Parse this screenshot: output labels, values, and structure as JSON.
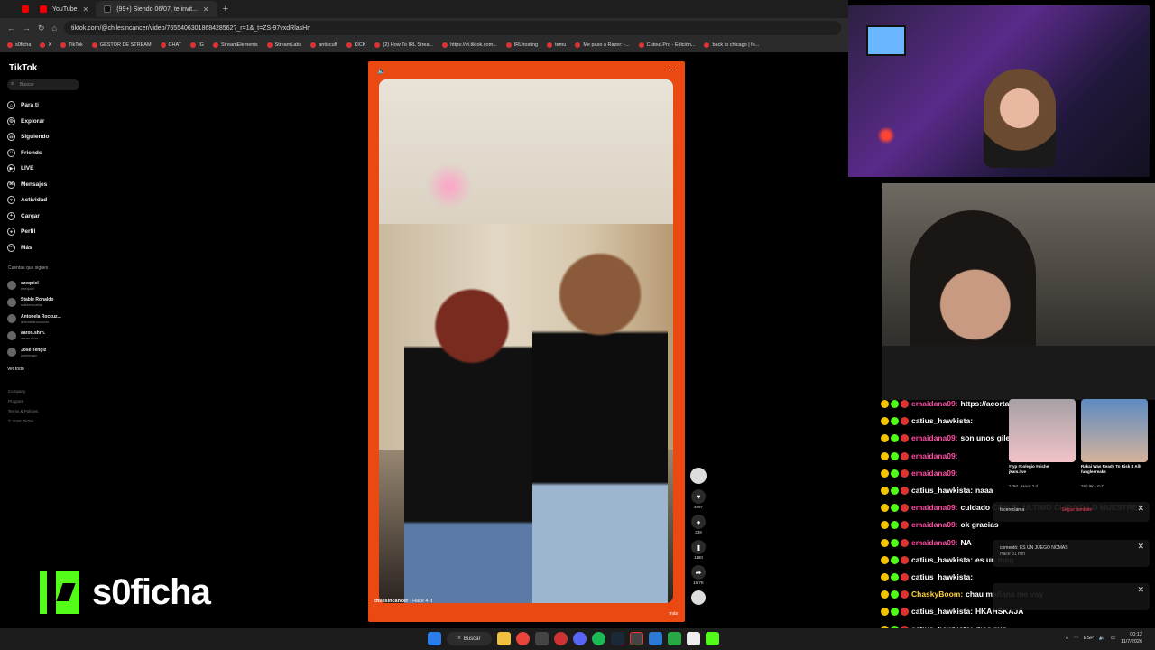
{
  "browser": {
    "tabs": [
      {
        "title": "YouTube"
      },
      {
        "title": "(99+) Siendo 06/07, te invit..."
      }
    ],
    "new_tab": "+",
    "url": "tiktok.com/@chilesincancer/video/7655406301868428562?_r=1&_t=ZS-97vxdRlasHn",
    "bookmarks": [
      "s0ficha",
      "X",
      "TikTok",
      "GESTOR DE STREAM",
      "CHAT",
      "IG",
      "StreamElements",
      "StreamLabs",
      "antiscuff",
      "KICK",
      "(2) How To IRL Strea...",
      "https://vt.tiktok.com...",
      "IRLhosting",
      "temu",
      "Me paso a Razer: -...",
      "Cutout.Pro - Edición...",
      "back to chicago | fe..."
    ]
  },
  "tiktok": {
    "logo": "TikTok",
    "search_placeholder": "Buscar",
    "nav": [
      {
        "label": "Para ti",
        "icon": "home-icon"
      },
      {
        "label": "Explorar",
        "icon": "compass-icon"
      },
      {
        "label": "Siguiendo",
        "icon": "following-icon"
      },
      {
        "label": "Friends",
        "icon": "friends-icon"
      },
      {
        "label": "LIVE",
        "icon": "live-icon"
      },
      {
        "label": "Mensajes",
        "icon": "message-icon"
      },
      {
        "label": "Actividad",
        "icon": "activity-icon"
      },
      {
        "label": "Cargar",
        "icon": "upload-icon"
      },
      {
        "label": "Perfil",
        "icon": "profile-icon"
      },
      {
        "label": "Más",
        "icon": "more-icon"
      }
    ],
    "following_title": "Cuentas que sigues",
    "following": [
      {
        "name": "ezequiel",
        "handle": "ezequiel"
      },
      {
        "name": "Stable Ronaldo",
        "handle": "stableronaldo"
      },
      {
        "name": "Antonela Roccuz...",
        "handle": "antonelaroccuzzo"
      },
      {
        "name": "aaron.shrn.",
        "handle": "aaron.shrn"
      },
      {
        "name": "Jose Tengiz",
        "handle": "josetengiz"
      }
    ],
    "see_all": "Ver todo",
    "footer": [
      "Company",
      "Program",
      "Terms & Policies",
      "© 2026 TikTok"
    ],
    "video": {
      "author": "chilesincancer",
      "age": "· Hace 4 d",
      "more": "más",
      "counts": {
        "likes": "4697",
        "comments": "239",
        "saves": "1180",
        "shares": "16,7K"
      }
    }
  },
  "chat": {
    "messages": [
      {
        "user": "emaidana09:",
        "text": "https://acortar.link/colIu0 na",
        "color": "#ff4da6"
      },
      {
        "user": "catius_hawkista:",
        "text": "",
        "color": "#ffffff"
      },
      {
        "user": "emaidana09:",
        "text": "son unos giles",
        "color": "#ff4da6"
      },
      {
        "user": "emaidana09:",
        "text": "",
        "color": "#ff4da6"
      },
      {
        "user": "emaidana09:",
        "text": "",
        "color": "#ff4da6"
      },
      {
        "user": "catius_hawkista:",
        "text": "naaa",
        "color": "#ffffff"
      },
      {
        "user": "emaidana09:",
        "text": "cuidado CON EL ULTIMO CLIP NO LO MUESTRES",
        "color": "#ff4da6"
      },
      {
        "user": "emaidana09:",
        "text": "ok gracias",
        "color": "#ff4da6"
      },
      {
        "user": "emaidana09:",
        "text": "NA",
        "color": "#ff4da6"
      },
      {
        "user": "catius_hawkista:",
        "text": "es un mog",
        "color": "#ffffff"
      },
      {
        "user": "catius_hawkista:",
        "text": "",
        "color": "#ffffff"
      },
      {
        "user": "ChaskyBoom:",
        "text": "chau mañana me voy",
        "color": "#ffd23c"
      },
      {
        "user": "catius_hawkista:",
        "text": "HKAHSKAJA",
        "color": "#ffffff"
      },
      {
        "user": "catius_hawkista:",
        "text": "dios mio",
        "color": "#ffffff"
      }
    ]
  },
  "popups": {
    "thumb1_caption": "#fyp #colegio #niche",
    "thumb1_author": "jkam.live",
    "thumb1_views": "2.3M · Hace 3 d",
    "thumb2_caption": "Rakai Was Ready To Risk It All!",
    "thumb2_author": "funglesreaks",
    "thumb2_views": "260.9K · 6-7",
    "follow_back_user": "facereclama",
    "follow_back": "Seguir también",
    "comment_text": "comentó: ES UN JUEGO NOMAS",
    "comment_time": "Hace 31 min"
  },
  "brand": {
    "name": "s0ficha"
  },
  "taskbar": {
    "search": "Buscar",
    "lang": "ESP",
    "time": "00:12",
    "date": "11/7/2026"
  },
  "colors": {
    "video_border": "#ea4a12",
    "kick_green": "#53fc18"
  }
}
